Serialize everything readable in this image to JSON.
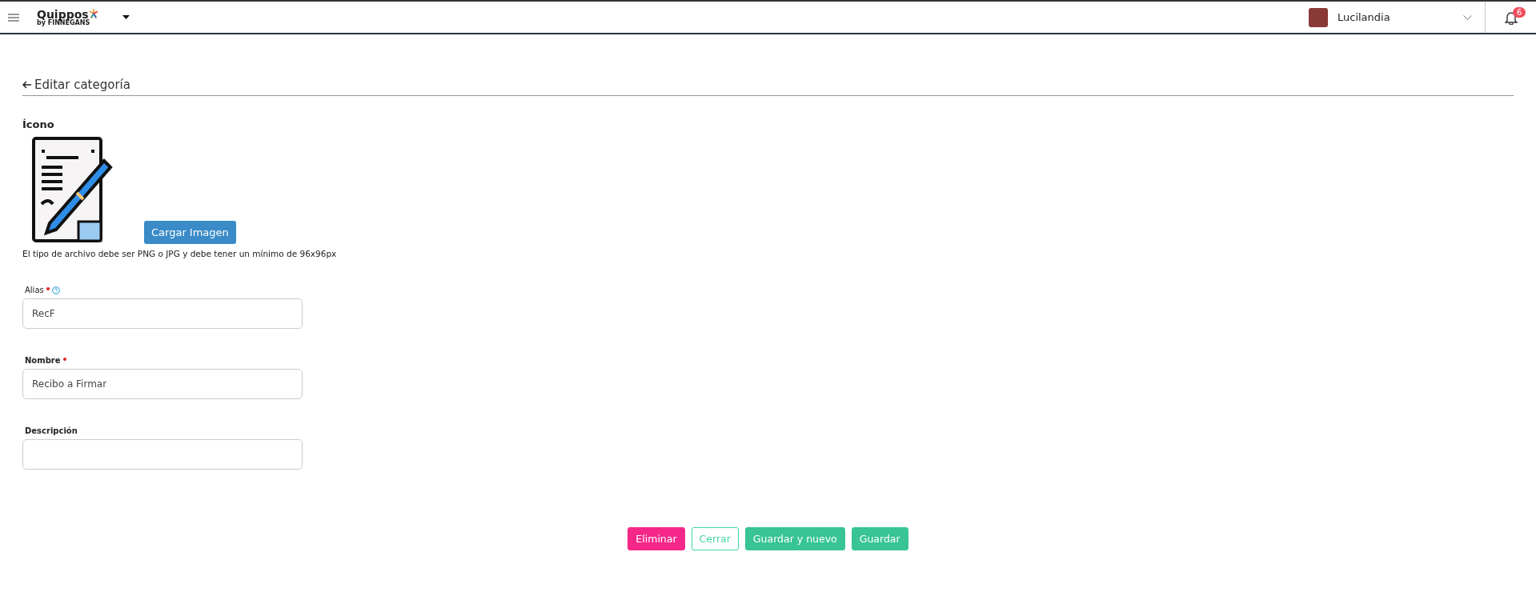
{
  "header": {
    "logo": {
      "name": "Quippos",
      "sub": "by FINNEGANS"
    },
    "user": "Lucilandia",
    "notifications": "6"
  },
  "page": {
    "title": "Editar categoría"
  },
  "icon_section": {
    "label": "Ícono",
    "upload_button": "Cargar Imagen",
    "hint": "El tipo de archivo debe ser PNG o JPG y debe tener un mínimo de 96x96px"
  },
  "fields": [
    {
      "label": "Alias",
      "required": true,
      "help": true,
      "bold": false,
      "value": "RecF"
    },
    {
      "label": "Nombre",
      "required": true,
      "help": false,
      "bold": true,
      "value": "Recibo a Firmar"
    },
    {
      "label": "Descripción",
      "required": false,
      "help": false,
      "bold": true
    }
  ],
  "buttons": [
    {
      "label": "Eliminar",
      "kind": "danger"
    },
    {
      "label": "Cerrar",
      "kind": "outline"
    },
    {
      "label": "Guardar y nuevo",
      "kind": "primary"
    },
    {
      "label": "Guardar",
      "kind": "primary"
    }
  ]
}
